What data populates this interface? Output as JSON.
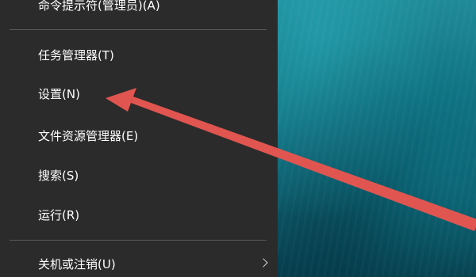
{
  "menu": {
    "items": [
      {
        "name": "menu-item-command-prompt-admin",
        "label": "命令提示符(管理员)(A)"
      },
      {
        "name": "menu-item-task-manager",
        "label": "任务管理器(T)"
      },
      {
        "name": "menu-item-settings",
        "label": "设置(N)"
      },
      {
        "name": "menu-item-file-explorer",
        "label": "文件资源管理器(E)"
      },
      {
        "name": "menu-item-search",
        "label": "搜索(S)"
      },
      {
        "name": "menu-item-run",
        "label": "运行(R)"
      },
      {
        "name": "menu-item-shutdown-signout",
        "label": "关机或注销(U)"
      }
    ]
  },
  "annotation": {
    "arrow_color": "#e05550",
    "arrow_target": "menu-item-settings"
  },
  "icons": {
    "submenu": "chevron-right-icon"
  }
}
